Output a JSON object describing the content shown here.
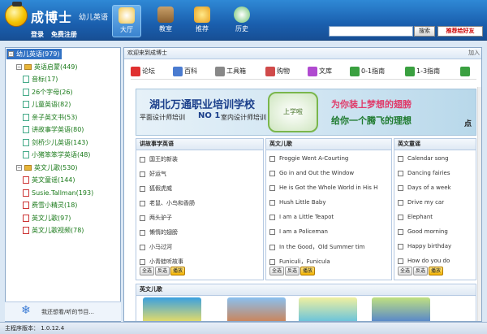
{
  "app": {
    "name": "成博士",
    "subtitle": "幼儿英语",
    "login": "登录",
    "register": "免费注册"
  },
  "nav": [
    {
      "label": "大厅"
    },
    {
      "label": "教室"
    },
    {
      "label": "推荐"
    },
    {
      "label": "历史"
    }
  ],
  "search": {
    "placeholder": "",
    "button": "搜索",
    "recommend": "推荐给好友"
  },
  "sidebar": {
    "items": [
      {
        "label": "幼儿英语(979)",
        "level": 0,
        "selected": true,
        "type": "root"
      },
      {
        "label": "英语启蒙(449)",
        "level": 1,
        "type": "folder"
      },
      {
        "label": "音标(17)",
        "level": 2,
        "type": "leaf"
      },
      {
        "label": "26个字母(26)",
        "level": 2,
        "type": "leaf"
      },
      {
        "label": "儿童英语(82)",
        "level": 2,
        "type": "leaf"
      },
      {
        "label": "亲子英文书(53)",
        "level": 2,
        "type": "leaf"
      },
      {
        "label": "讲故事学英语(80)",
        "level": 2,
        "type": "leaf"
      },
      {
        "label": "剑桥少儿英语(143)",
        "level": 2,
        "type": "leaf"
      },
      {
        "label": "小猪笨笨学英语(48)",
        "level": 2,
        "type": "leaf"
      },
      {
        "label": "英文儿歌(530)",
        "level": 1,
        "type": "folder"
      },
      {
        "label": "英文童谣(144)",
        "level": 2,
        "type": "leafred"
      },
      {
        "label": "Susie.Tallman(193)",
        "level": 2,
        "type": "leafred"
      },
      {
        "label": "费雪小精灵(18)",
        "level": 2,
        "type": "leafred"
      },
      {
        "label": "英文儿歌(97)",
        "level": 2,
        "type": "leafred"
      },
      {
        "label": "英文儿歌视频(78)",
        "level": 2,
        "type": "leafred"
      }
    ],
    "footer": "我还想看/听的节目..."
  },
  "main": {
    "welcome": "欢迎来到成博士",
    "add": "加入",
    "menu": [
      {
        "label": "论坛",
        "color": "#e03030"
      },
      {
        "label": "百科",
        "color": "#4a7bd0"
      },
      {
        "label": "工具箱",
        "color": "#888888"
      },
      {
        "label": "购物",
        "color": "#d04a4a"
      },
      {
        "label": "文库",
        "color": "#b04ad0"
      },
      {
        "label": "0-1指南",
        "color": "#3aa040"
      },
      {
        "label": "1-3指南",
        "color": "#3aa040"
      },
      {
        "label": "",
        "color": "#3aa040"
      }
    ],
    "banner": {
      "school": "湖北万通职业培训学校",
      "line1": "平面设计师培训",
      "no1": "NO 1",
      "line2": "室内设计师培训",
      "tv": "上学啦",
      "slogan1": "为你装上梦想的翅膀",
      "slogan2": "给你一个腾飞的理想",
      "tail": "点"
    },
    "columns": [
      {
        "header": "讲故事学英语",
        "items": [
          "国王的新装",
          "好运气",
          "狐假虎威",
          "老鼠、小鸟和香肠",
          "两头驴子",
          "懒惰的翅膀",
          "小马过河",
          "小青蛙听故事"
        ],
        "buttons": [
          "全选",
          "反选",
          "播放"
        ]
      },
      {
        "header": "英文儿歌",
        "items": [
          "Froggie Went A-Courting",
          "Go in and Out the Window",
          "He is Got the Whole World in His H",
          "Hush Little Baby",
          "I am a Little Teapot",
          "I am a Policeman",
          "In the Good，Old Summer tim",
          "Funiculi，Funicula"
        ],
        "buttons": [
          "全选",
          "反选",
          "播放"
        ]
      },
      {
        "header": "英文童谣",
        "items": [
          "Calendar song",
          "Dancing fairies",
          "Days of a week",
          "Drive my car",
          "Elephant",
          "Good morning",
          "Happy birthday",
          "How do you do"
        ],
        "buttons": [
          "全选",
          "反选",
          "播放"
        ]
      }
    ],
    "section2": {
      "header": "英文儿歌"
    }
  },
  "status": {
    "text": "主程序版本： 1.0.12.4"
  },
  "colors": {
    "topbar": "#1a5fae",
    "accent": "#3272c4",
    "tree_text": "#1a7a1a"
  }
}
